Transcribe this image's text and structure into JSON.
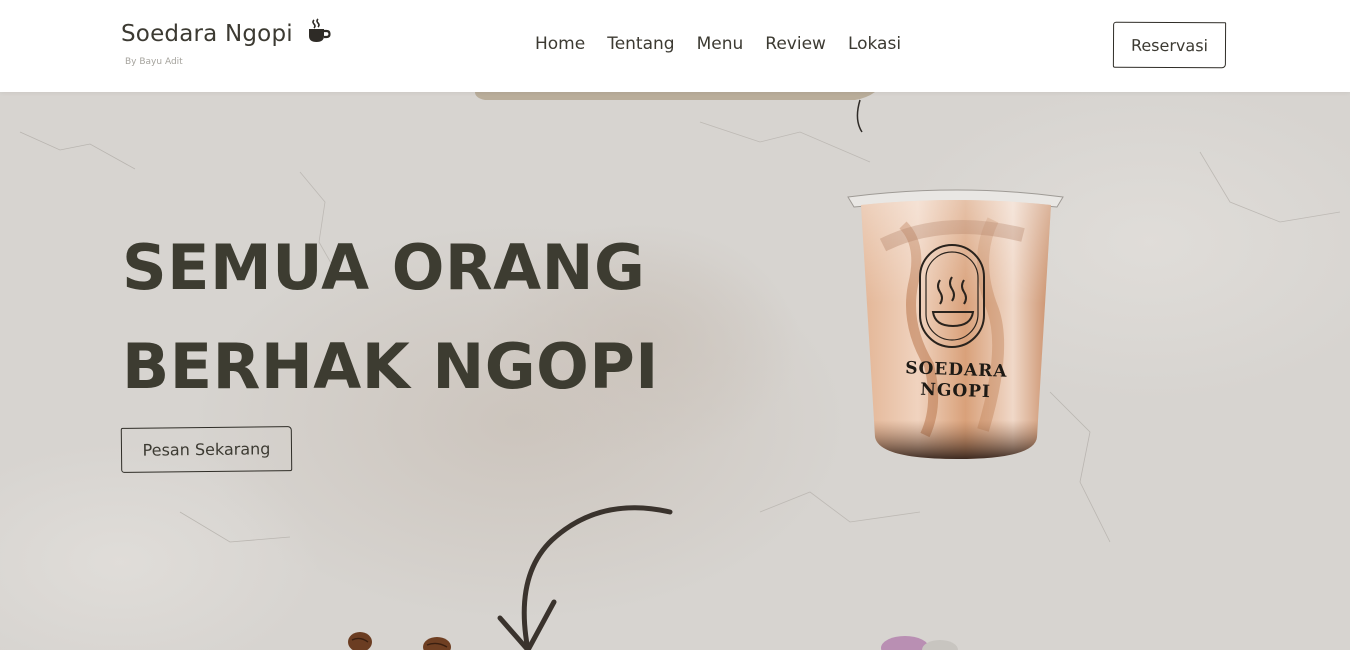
{
  "header": {
    "brand_name": "Soedara Ngopi",
    "brand_sub": "By Bayu Adit",
    "brand_icon": "coffee-cup-icon",
    "nav": [
      {
        "label": "Home"
      },
      {
        "label": "Tentang"
      },
      {
        "label": "Menu"
      },
      {
        "label": "Review"
      },
      {
        "label": "Lokasi"
      }
    ],
    "reserve_label": "Reservasi"
  },
  "hero": {
    "headline_line1": "SEMUA ORANG",
    "headline_line2": "BERHAK NGOPI",
    "cta_label": "Pesan Sekarang",
    "cup_label_line1": "SOEDARA",
    "cup_label_line2": "NGOPI"
  },
  "colors": {
    "text_dark": "#3d3c31",
    "background": "#d6d3cf",
    "header_bg": "#ffffff"
  }
}
